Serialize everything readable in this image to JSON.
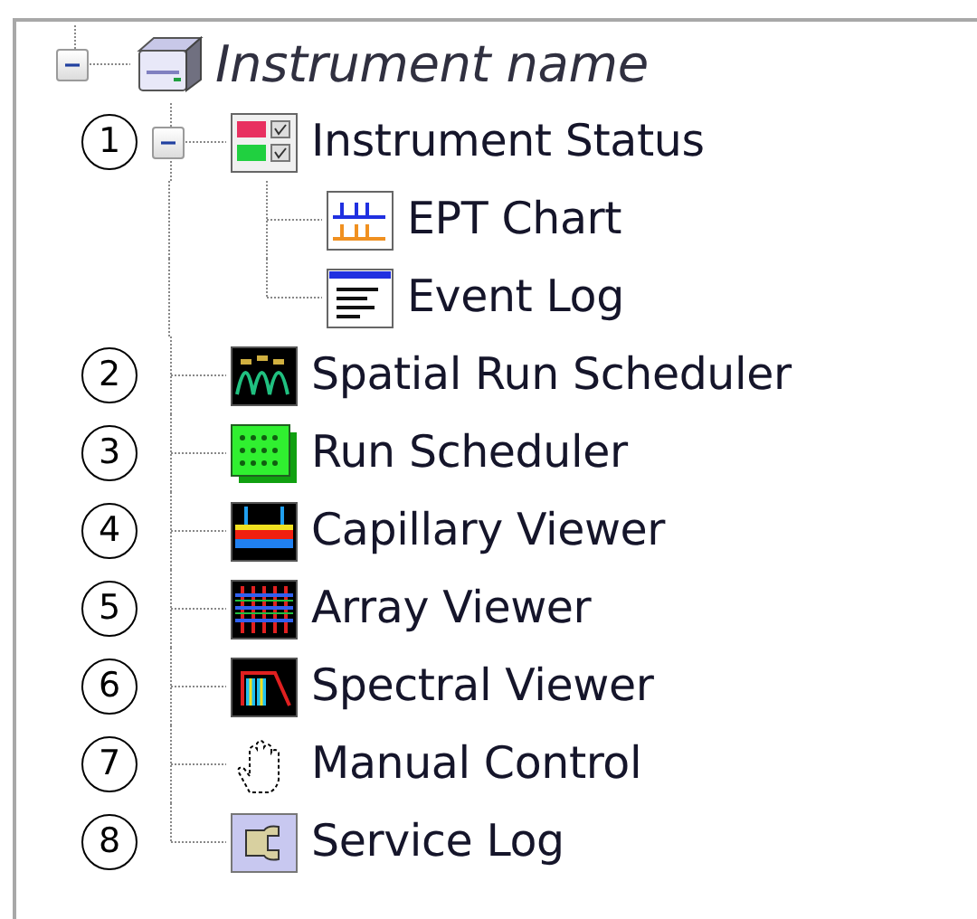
{
  "tree": {
    "label": "Instrument name",
    "expanded": true,
    "children": [
      {
        "callout": "1",
        "label": "Instrument Status",
        "expanded": true,
        "children": [
          {
            "label": "EPT Chart"
          },
          {
            "label": "Event Log"
          }
        ]
      },
      {
        "callout": "2",
        "label": "Spatial Run Scheduler"
      },
      {
        "callout": "3",
        "label": "Run Scheduler"
      },
      {
        "callout": "4",
        "label": "Capillary Viewer"
      },
      {
        "callout": "5",
        "label": "Array Viewer"
      },
      {
        "callout": "6",
        "label": "Spectral Viewer"
      },
      {
        "callout": "7",
        "label": "Manual Control"
      },
      {
        "callout": "8",
        "label": "Service Log"
      }
    ]
  }
}
